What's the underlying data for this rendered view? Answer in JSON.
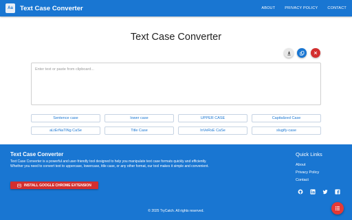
{
  "navbar": {
    "logo_text": "Aa",
    "brand": "Text Case Converter",
    "links": [
      "ABOUT",
      "PRIVACY POLICY",
      "CONTACT"
    ],
    "color": "#1976d2"
  },
  "main": {
    "title": "Text Case Converter",
    "actions": [
      {
        "name": "download-icon",
        "color": "#e8e8e8"
      },
      {
        "name": "copy-icon",
        "color": "#1976d2"
      },
      {
        "name": "close-icon",
        "color": "#d32f2f"
      }
    ],
    "input": {
      "placeholder": "Enter text or paste from clipboard...",
      "value": ""
    },
    "case_buttons": [
      "Sentence case",
      "lower case",
      "UPPER CASE",
      "Capitalized Case",
      "aLtErNaTiNg CaSe",
      "Title Case",
      "InVeRsE CaSe",
      "slugify-case"
    ]
  },
  "footer": {
    "title": "Text Case Converter",
    "description": "Text Case Converter is a powerful and user-friendly tool designed to help you manipulate text case formats quickly and efficiently. Whether you need to convert text to uppercase, lowercase, title case, or any other format, our tool makes it simple and convenient.",
    "chrome_button": "INSTALL GOOGLE CHROME EXTENSION",
    "quick_links_title": "Quick Links",
    "quick_links": [
      "About",
      "Privacy Policy",
      "Contact"
    ],
    "social_icons": [
      "github-icon",
      "linkedin-icon",
      "twitter-icon",
      "facebook-icon"
    ],
    "copyright": "© 2025 TryCatch. All rights reserved.",
    "fab_icon": "menu-icon",
    "fab_color": "#e53935"
  }
}
